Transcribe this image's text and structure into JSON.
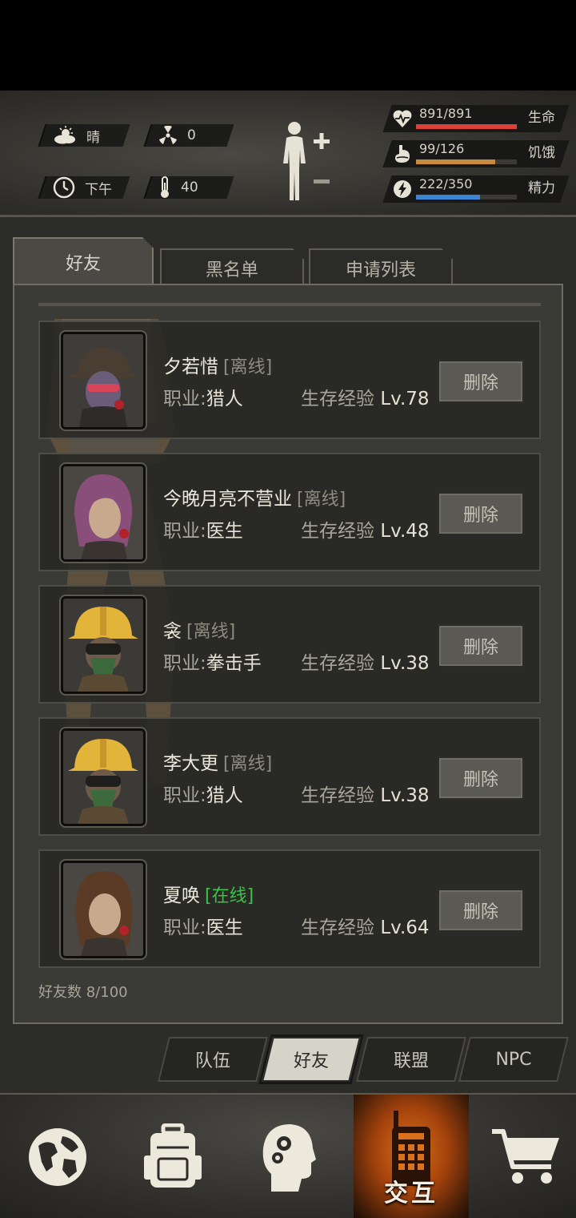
{
  "status": {
    "weather": "晴",
    "radiation": "0",
    "time": "下午",
    "temperature": "40"
  },
  "vitals": [
    {
      "key": "health",
      "value": "891/891",
      "label": "生命",
      "fraction": 1.0,
      "color": "#d9413b",
      "icon": "heart-icon"
    },
    {
      "key": "hunger",
      "value": "99/126",
      "label": "饥饿",
      "fraction": 0.786,
      "color": "#c58a3c",
      "icon": "stomach-icon"
    },
    {
      "key": "energy",
      "value": "222/350",
      "label": "精力",
      "fraction": 0.634,
      "color": "#3d86d6",
      "icon": "energy-icon"
    }
  ],
  "tabs": [
    "好友",
    "黑名单",
    "申请列表"
  ],
  "friends": [
    {
      "name": "夕若惜",
      "status": "[离线]",
      "online": false,
      "job_label": "职业:",
      "job": "猎人",
      "exp_label": "生存经验",
      "level": "Lv.78",
      "delete": "删除",
      "avatar": "hunter-avatar-icon"
    },
    {
      "name": "今晚月亮不营业",
      "status": "[离线]",
      "online": false,
      "job_label": "职业:",
      "job": "医生",
      "exp_label": "生存经验",
      "level": "Lv.48",
      "delete": "删除",
      "avatar": "doctor-avatar-icon"
    },
    {
      "name": "衾",
      "status": "[离线]",
      "online": false,
      "job_label": "职业:",
      "job": "拳击手",
      "exp_label": "生存经验",
      "level": "Lv.38",
      "delete": "删除",
      "avatar": "helmet-avatar-icon"
    },
    {
      "name": "李大更",
      "status": "[离线]",
      "online": false,
      "job_label": "职业:",
      "job": "猎人",
      "exp_label": "生存经验",
      "level": "Lv.38",
      "delete": "删除",
      "avatar": "helmet-avatar-icon"
    },
    {
      "name": "夏唤",
      "status": "[在线]",
      "online": true,
      "job_label": "职业:",
      "job": "医生",
      "exp_label": "生存经验",
      "level": "Lv.64",
      "delete": "删除",
      "avatar": "doctor-avatar-icon"
    }
  ],
  "friend_count": "好友数 8/100",
  "subtabs": [
    "队伍",
    "好友",
    "联盟",
    "NPC"
  ],
  "nav": {
    "items": [
      "globe-icon",
      "backpack-icon",
      "brain-head-icon",
      "walkie-talkie-icon",
      "cart-icon"
    ],
    "active_label": "交互"
  }
}
